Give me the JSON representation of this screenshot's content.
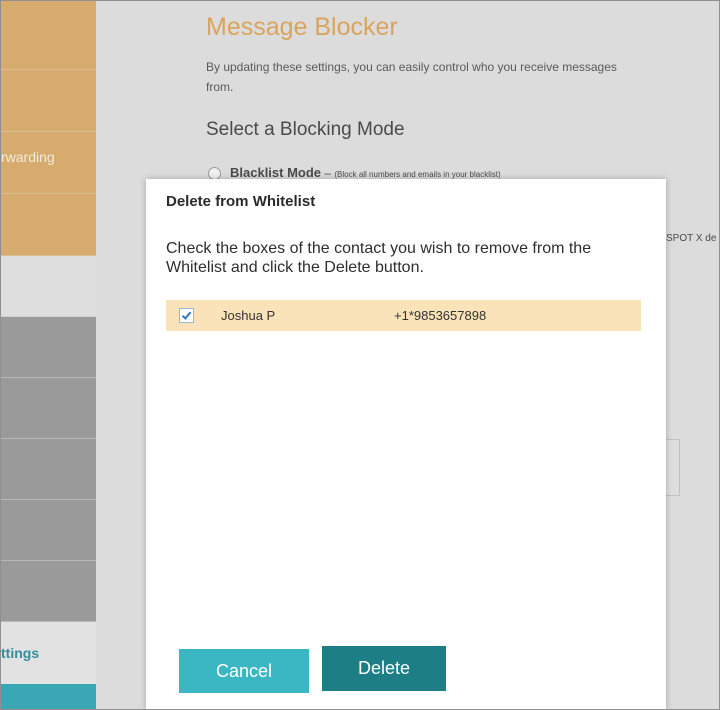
{
  "sidebar": {
    "items": [
      {
        "label": ""
      },
      {
        "label": ""
      },
      {
        "label": "rwarding"
      },
      {
        "label": ""
      }
    ],
    "settings_label": "ttings"
  },
  "page": {
    "title": "Message Blocker",
    "description": "By updating these settings, you can easily control who you receive messages from.",
    "subtitle": "Select a Blocking Mode",
    "blacklist_mode_label": "Blacklist Mode",
    "blacklist_mode_separator": " – ",
    "blacklist_mode_note": "(Block all numbers and emails in your blacklist)",
    "right_text": "SPOT X de"
  },
  "modal": {
    "title": "Delete from Whitelist",
    "instructions": "Check the boxes of the contact you wish to remove from the Whitelist and click the Delete button.",
    "contacts": [
      {
        "name": "Joshua P",
        "phone": "+1*9853657898",
        "checked": true
      }
    ],
    "cancel_label": "Cancel",
    "delete_label": "Delete"
  },
  "colors": {
    "accent_orange": "#d9a45c",
    "teal": "#3bb7c4",
    "teal_dark": "#1d7e86",
    "row_highlight": "#fbe3b9"
  }
}
